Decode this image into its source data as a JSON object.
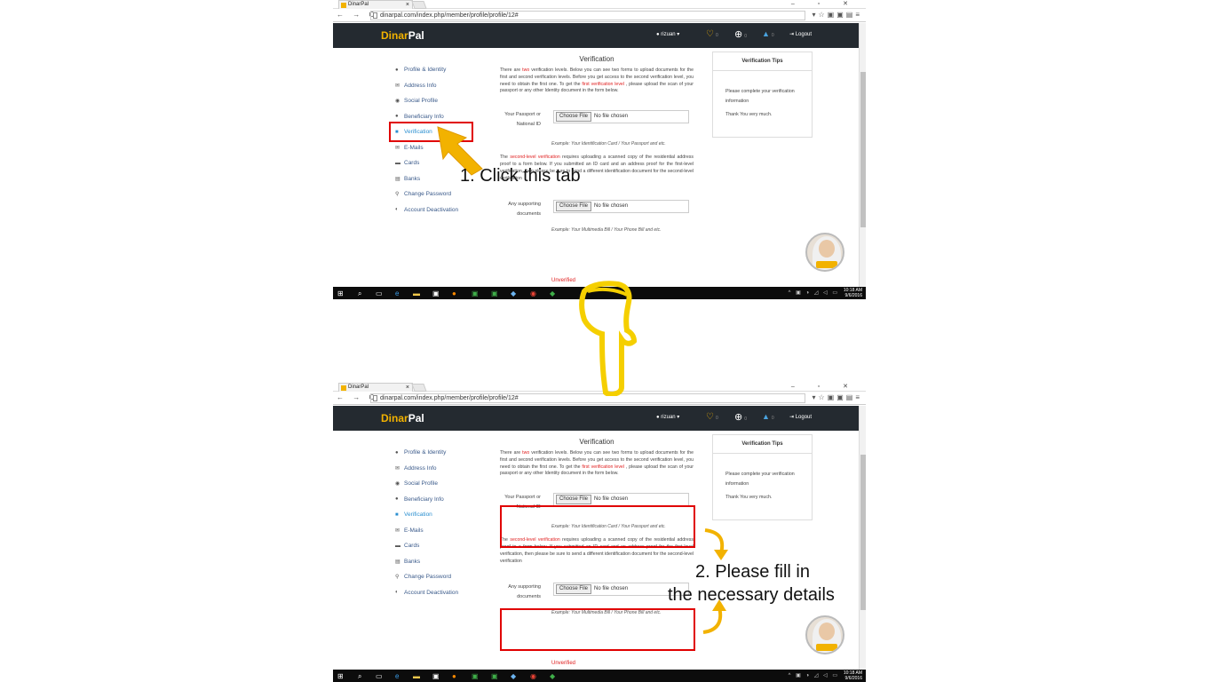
{
  "browser": {
    "tab_title": "DinarPal",
    "url": "dinarpal.com/index.php/member/profile/profile/12#"
  },
  "site": {
    "logo": "DinarPal",
    "logo_part1": "Dinar",
    "logo_part2": "Pal",
    "user": "rizuan ▾",
    "wish_count": "0",
    "global_count": "0",
    "notif_count": "0",
    "logout": "Logout"
  },
  "sidebar": {
    "items": [
      {
        "label": "Profile & Identity",
        "icon": "user-icon"
      },
      {
        "label": "Address Info",
        "icon": "envelope-icon"
      },
      {
        "label": "Social Profile",
        "icon": "globe-icon"
      },
      {
        "label": "Beneficiary Info",
        "icon": "users-icon"
      },
      {
        "label": "Verification",
        "icon": "lock-icon"
      },
      {
        "label": "E-Mails",
        "icon": "envelope-icon"
      },
      {
        "label": "Cards",
        "icon": "card-icon"
      },
      {
        "label": "Banks",
        "icon": "bank-icon"
      },
      {
        "label": "Change Password",
        "icon": "key-icon"
      },
      {
        "label": "Account Deactivation",
        "icon": "adjust-icon"
      }
    ]
  },
  "main": {
    "title": "Verification",
    "intro_1": "There are ",
    "intro_two": "two",
    "intro_2": " verification levels. Below you can see two forms to upload documents for the first and second verification levels. Before you get access to the second verification level, you need to obtain the first one. To get the ",
    "intro_first": "first verification level",
    "intro_3": " , please upload the scan of your passport or any other Identity document in the form below.",
    "passport_label": "Your Passport or National ID",
    "choose_file": "Choose File",
    "no_file": "No file chosen",
    "passport_example": "Example: Your Identification Card / Your Passport and etc.",
    "second_red": "second-level verification",
    "second_pre": "The ",
    "second_text": " requires uploading a scanned copy of the residential address proof to a form below. If you submitted an ID card and an address proof for the first-level verification, then please be sure to send a different identification document for the second-level verification",
    "supporting_label": "Any supporting documents",
    "supporting_example": "Example: Your Multimedia Bill / Your Phone Bill and etc.",
    "status": "Unverified"
  },
  "tips": {
    "title": "Verification Tips",
    "line1": "Please complete your verification information",
    "line2": "Thank You very much."
  },
  "taskbar": {
    "time": "10:18 AM",
    "date": "9/6/2016"
  },
  "annotations": {
    "step1": "1. Click this tab",
    "step2_line1": "2. Please fill in",
    "step2_line2": "the  necessary details"
  },
  "colors": {
    "nav_bg": "#242a30",
    "brand": "#f2b200",
    "highlight": "#e00000",
    "arrow": "#f2b200",
    "hand": "#f5cf00"
  }
}
